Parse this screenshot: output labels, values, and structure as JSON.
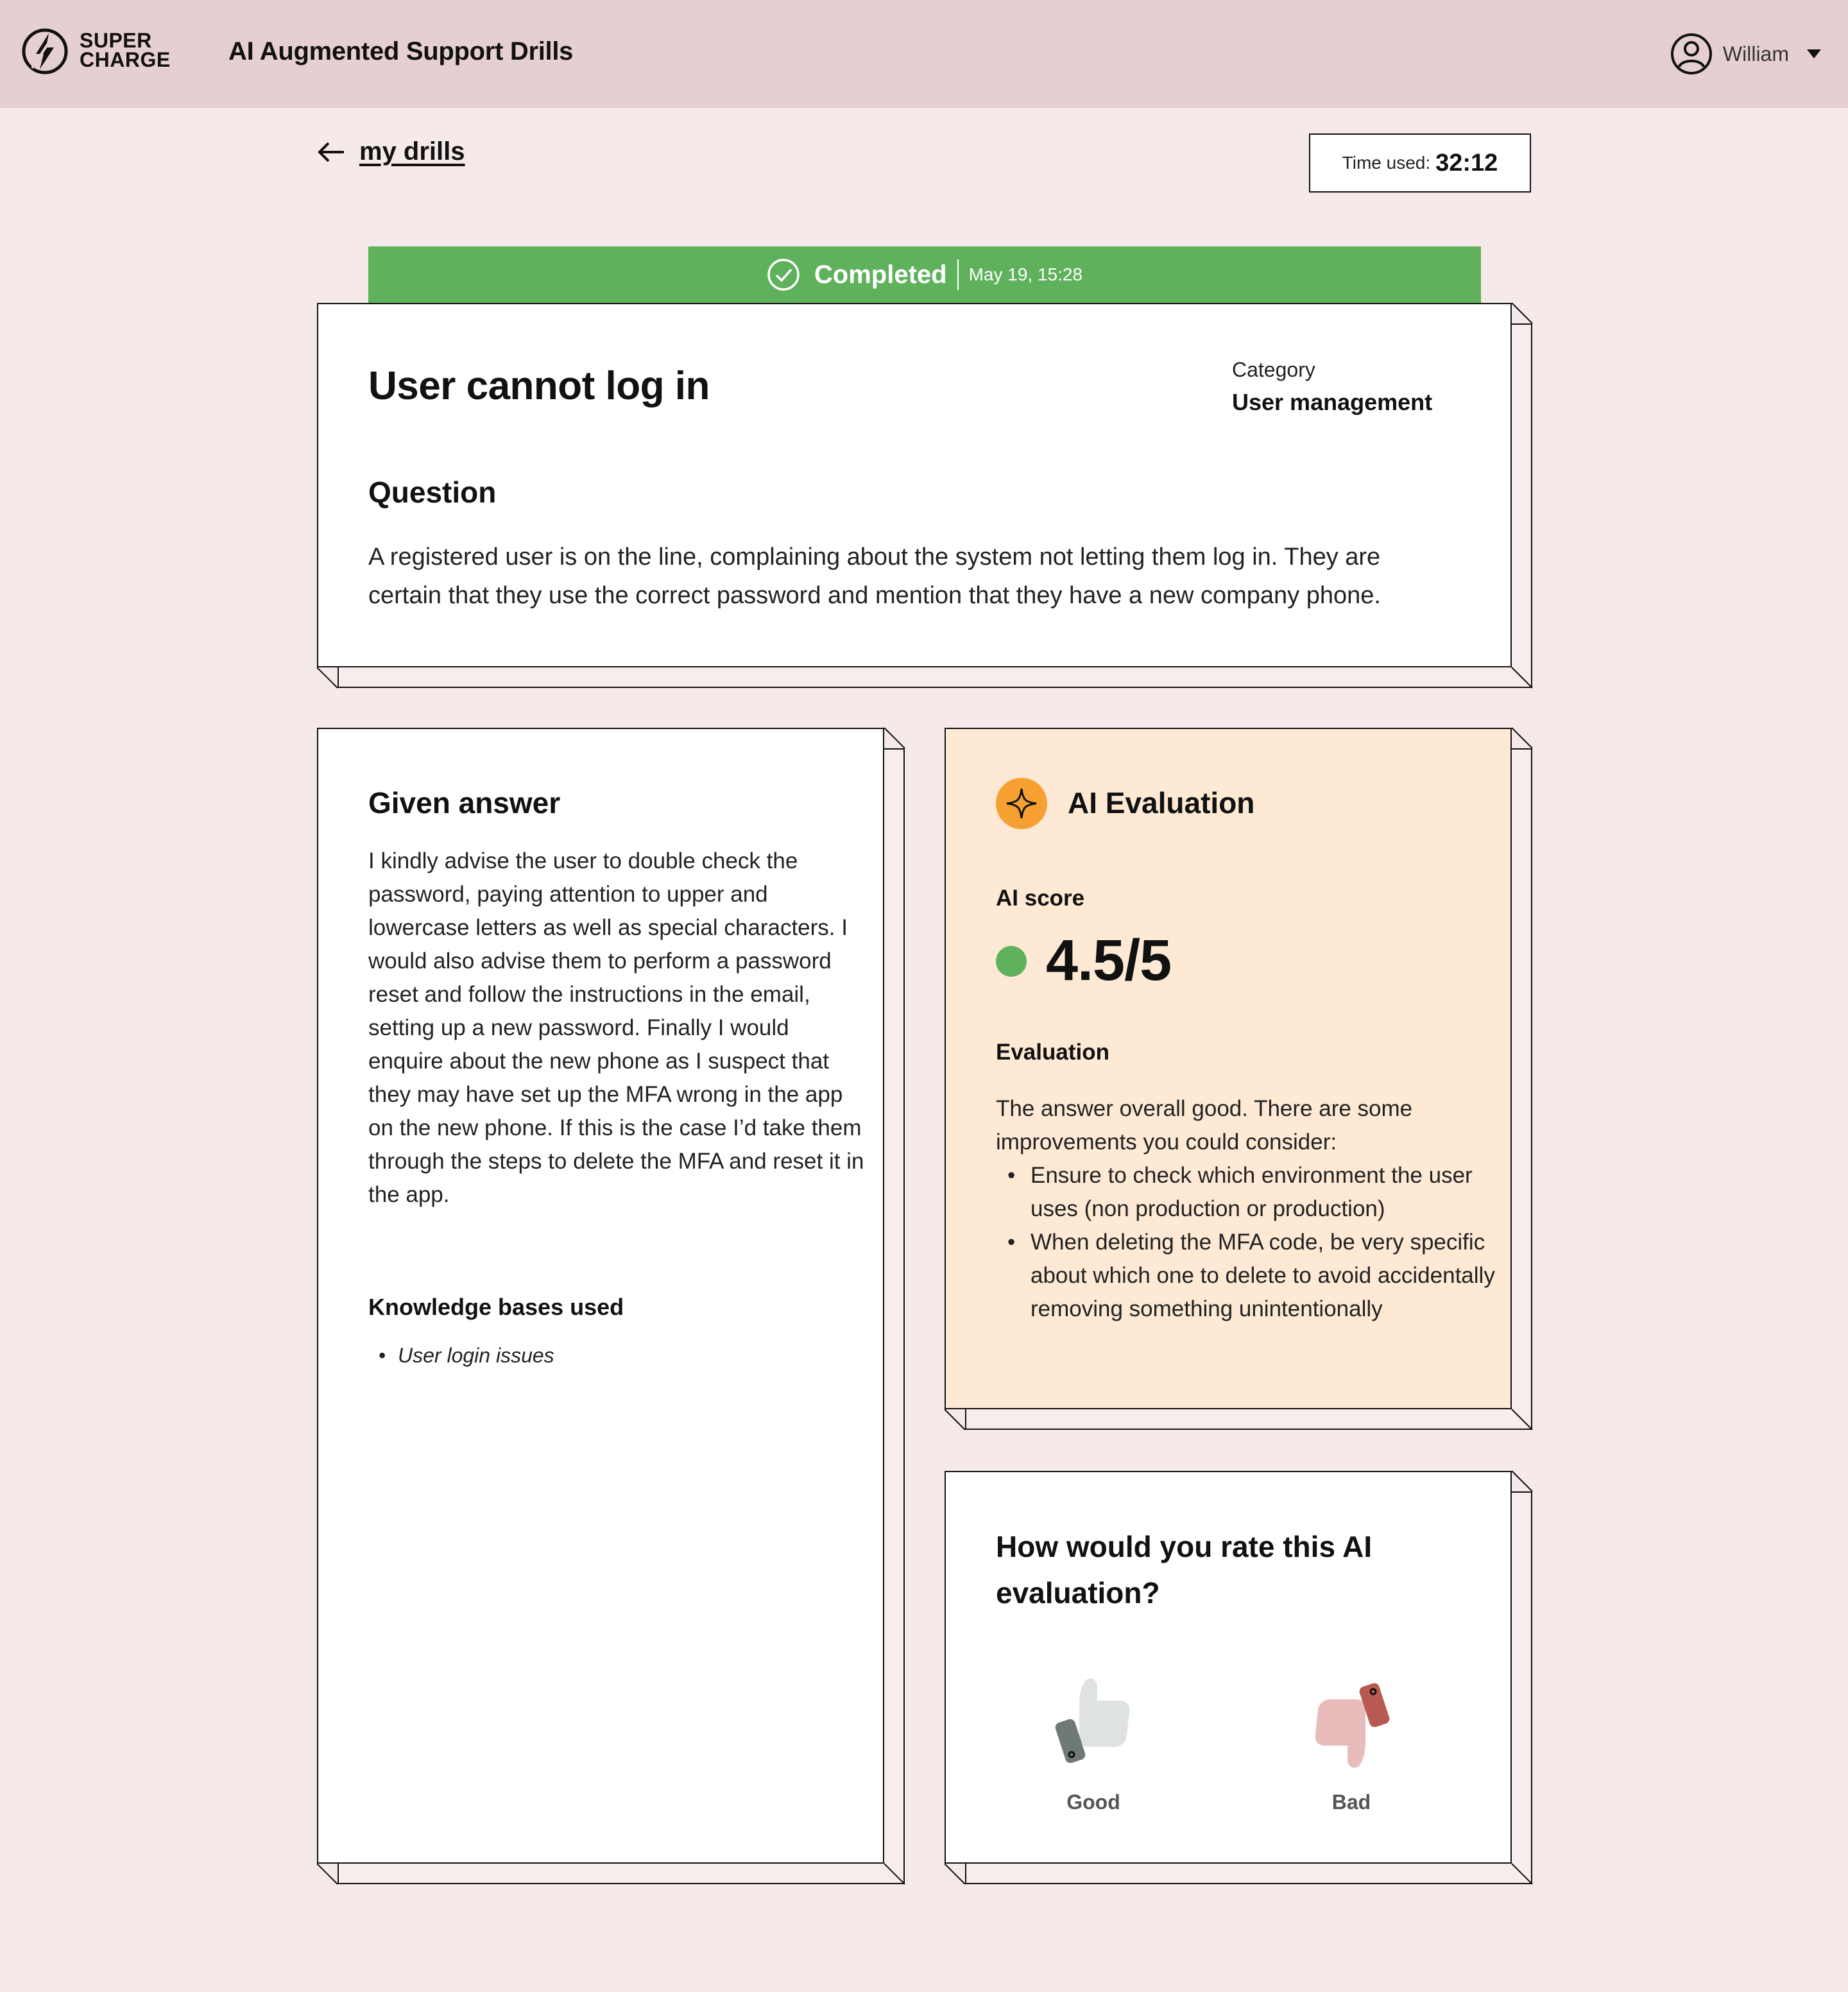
{
  "header": {
    "logo_line1": "SUPER",
    "logo_line2": "CHARGE",
    "title": "AI Augmented Support Drills",
    "user_name": "William"
  },
  "nav": {
    "back_label": "my drills"
  },
  "timer": {
    "label": "Time used:",
    "value": "32:12"
  },
  "status": {
    "label": "Completed",
    "date": "May 19, 15:28",
    "color": "#5fb15c"
  },
  "question": {
    "title": "User cannot log in",
    "category_label": "Category",
    "category_value": "User management",
    "heading": "Question",
    "body": "A registered user is on the line, complaining about the system not letting them log in. They are certain that they use the correct password and mention that they have a new company phone."
  },
  "given_answer": {
    "heading": "Given answer",
    "body": "I kindly advise the user to double check the password, paying attention to upper and lowercase letters as well as special characters. I would also advise them to perform a password reset and follow the instructions in the email, setting up a new password. Finally I would enquire about the new phone as I suspect that they may have set up the MFA wrong in the app on the new phone. If this is the case I’d take them through the steps to delete the MFA and reset it in the app.",
    "kb_heading": "Knowledge bases used",
    "kb_items": [
      "User login issues"
    ]
  },
  "ai_evaluation": {
    "heading": "AI Evaluation",
    "score_label": "AI score",
    "score_value": "4.5/5",
    "score_color": "#5fb15c",
    "eval_label": "Evaluation",
    "eval_intro": "The answer overall good. There are some improvements you could consider:",
    "eval_points": [
      "Ensure to check which environment the user uses (non production or production)",
      "When deleting the MFA code, be very specific about which one to delete to avoid accidentally removing something unintentionally"
    ],
    "background": "#fde9d4",
    "icon_color": "#f5a030"
  },
  "rating": {
    "heading": "How would you rate this AI evaluation?",
    "good_label": "Good",
    "bad_label": "Bad"
  }
}
